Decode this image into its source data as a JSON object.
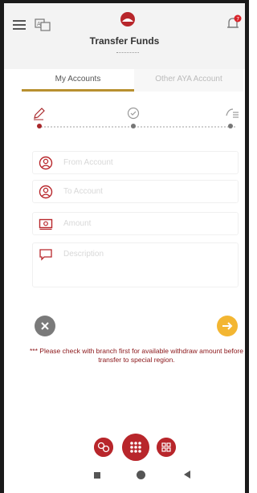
{
  "header": {
    "title": "Transfer Funds",
    "notification_badge": "7",
    "brand_color": "#b8262b"
  },
  "tabs": [
    {
      "label": "My Accounts",
      "active": true
    },
    {
      "label": "Other AYA Account",
      "active": false
    }
  ],
  "steps": [
    {
      "icon": "pencil-icon",
      "state": "current"
    },
    {
      "icon": "check-badge-icon",
      "state": "pending"
    },
    {
      "icon": "confirm-list-icon",
      "state": "pending"
    }
  ],
  "form": {
    "from_account_placeholder": "From Account",
    "to_account_placeholder": "To Account",
    "amount_placeholder": "Amount",
    "description_placeholder": "Description"
  },
  "note": "*** Please check with branch first for available withdraw amount before transfer to special region.",
  "bottom_bar": {
    "icons": [
      "swap-icon",
      "apps-grid-icon",
      "qr-icon"
    ]
  },
  "colors": {
    "accent": "#b8262b",
    "tab_underline": "#b89030",
    "next_button": "#f3b632",
    "close_button": "#7a7a7a",
    "note_text": "#8a1518"
  }
}
